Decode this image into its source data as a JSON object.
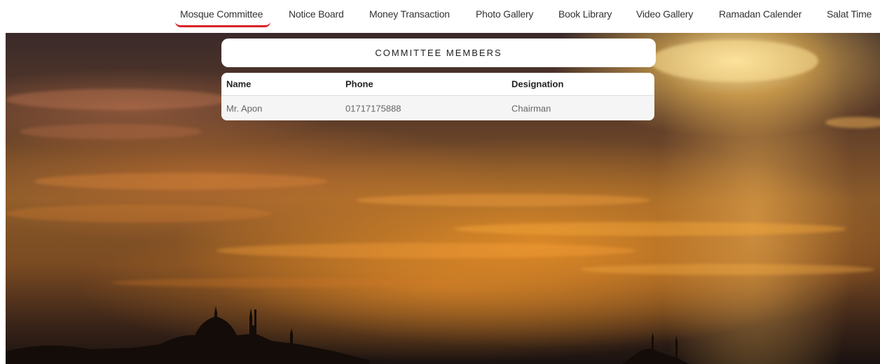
{
  "nav": {
    "items": [
      {
        "label": "Mosque Committee",
        "active": true
      },
      {
        "label": "Notice Board",
        "active": false
      },
      {
        "label": "Money Transaction",
        "active": false
      },
      {
        "label": "Photo Gallery",
        "active": false
      },
      {
        "label": "Book Library",
        "active": false
      },
      {
        "label": "Video Gallery",
        "active": false
      },
      {
        "label": "Ramadan Calender",
        "active": false
      },
      {
        "label": "Salat Time",
        "active": false
      }
    ],
    "active_color": "#d92128"
  },
  "committee": {
    "title": "COMMITTEE MEMBERS",
    "columns": [
      "Name",
      "Phone",
      "Designation"
    ],
    "rows": [
      [
        "Mr. Apon",
        "01717175888",
        "Chairman"
      ]
    ]
  }
}
